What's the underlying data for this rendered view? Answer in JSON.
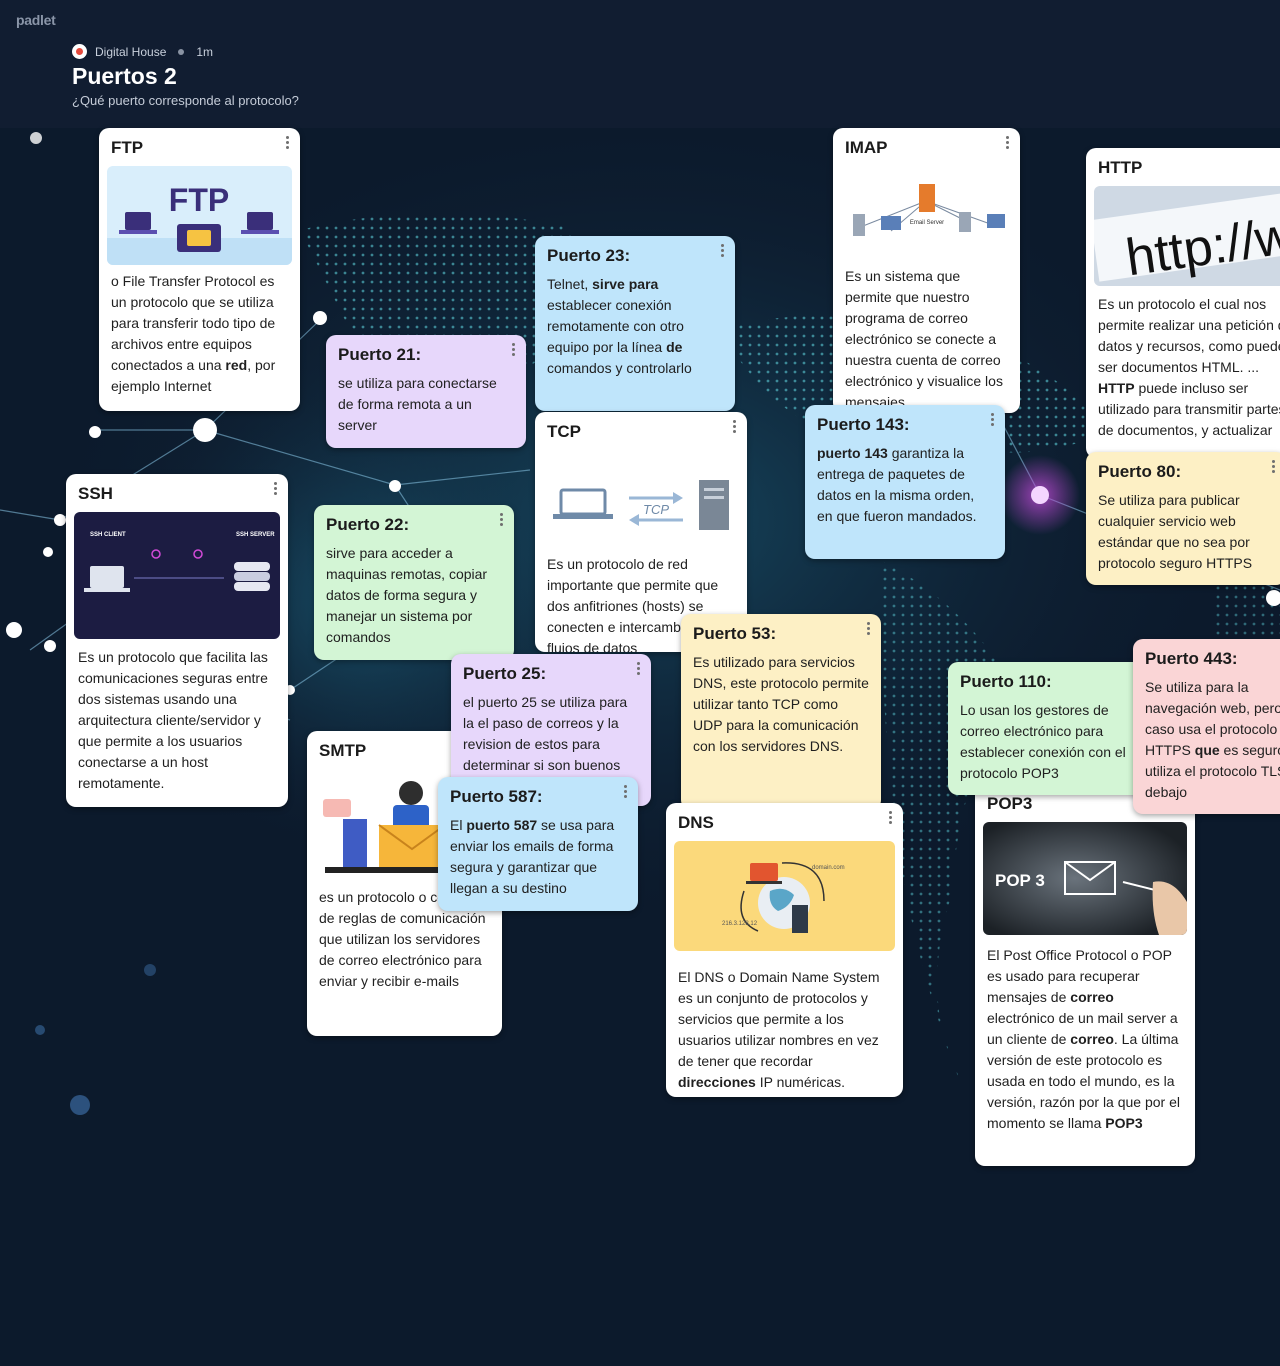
{
  "brand": "padlet",
  "header": {
    "author": "Digital House",
    "time": "1m",
    "title": "Puertos 2",
    "subtitle": "¿Qué puerto corresponde al protocolo?"
  },
  "colors": {
    "background": "#0f1b2e",
    "purple": "#e7d7fb",
    "blue": "#bfe5fb",
    "green": "#d3f5d5",
    "yellow": "#fdf0c5",
    "pink": "#fad5d6"
  },
  "cards": {
    "ftp": {
      "title": "FTP",
      "image_text": "FTP",
      "b1": "o File Transfer Protocol es un protocolo que se utiliza para transferir todo tipo de archivos entre equipos conectados a una ",
      "b2": "red",
      "b3": ", por ejemplo Internet"
    },
    "puerto21": {
      "title": "Puerto 21:",
      "body": "se utiliza para conectarse de forma remota a un server"
    },
    "puerto23": {
      "title": "Puerto 23:",
      "b1": "Telnet, ",
      "b2": "sirve para",
      "b3": " establecer conexión remotamente con otro equipo por la línea ",
      "b4": "de",
      "b5": " comandos y controlarlo"
    },
    "imap": {
      "title": "IMAP",
      "image_text": "Email Server",
      "body": "Es un sistema que permite que nuestro programa de correo electrónico se conecte a nuestra cuenta de correo electrónico y visualice los mensajes"
    },
    "http": {
      "title": "HTTP",
      "image_text": "http://ww",
      "b1": "Es un protocolo el cual nos permite realizar una petición de datos y recursos, como pueden ser documentos HTML. ... ",
      "b2": "HTTP",
      "b3": " puede incluso ser utilizado para transmitir partes de documentos, y actualizar"
    },
    "tcp": {
      "title": "TCP",
      "image_text": "TCP",
      "body": "Es un protocolo de red importante que permite que dos anfitriones (hosts) se conecten e intercambien flujos de datos"
    },
    "puerto143": {
      "title": "Puerto 143:",
      "b1": "puerto 143",
      "b2": " garantiza la entrega de paquetes de datos en la misma orden, en que fueron mandados."
    },
    "puerto80": {
      "title": "Puerto 80:",
      "body": "Se utiliza para publicar cualquier servicio web estándar que no sea por protocolo seguro HTTPS"
    },
    "ssh": {
      "title": "SSH",
      "image_client": "SSH CLIENT",
      "image_server": "SSH SERVER",
      "body": "Es un protocolo que facilita las comunicaciones seguras entre dos sistemas usando una arquitectura cliente/servidor y que permite a los usuarios conectarse a un host remotamente."
    },
    "puerto22": {
      "title": "Puerto 22:",
      "body": "sirve para acceder a maquinas remotas,  copiar datos de forma segura y manejar un sistema por comandos"
    },
    "puerto53": {
      "title": "Puerto 53:",
      "body": "Es utilizado para servicios DNS, este protocolo permite utilizar tanto TCP como UDP para la comunicación con los servidores DNS."
    },
    "puerto25": {
      "title": "Puerto 25:",
      "body": "el puerto 25 se utiliza para la el paso de correos y la revision de estos para determinar si son buenos"
    },
    "smtp": {
      "title": "SMTP",
      "body": "es un protocolo o conjunto de reglas de comunicación que utilizan los servidores de correo electrónico para enviar y recibir e-mails"
    },
    "puerto587": {
      "title": "Puerto 587:",
      "b1": "El ",
      "b2": "puerto 587",
      "b3": " se usa para enviar los emails de forma segura y garantizar que llegan a su destino"
    },
    "dns": {
      "title": "DNS",
      "image_domain": "domain.com",
      "image_ip": "216.3.128.12",
      "b1": "El DNS o Domain Name System es un conjunto de protocolos y servicios que permite a los usuarios utilizar nombres en vez de tener que recordar ",
      "b2": "direcciones",
      "b3": " IP numéricas."
    },
    "puerto110": {
      "title": "Puerto 110:",
      "body": "Lo usan los gestores de correo electrónico para establecer conexión con el protocolo POP3"
    },
    "puerto443": {
      "title": "Puerto 443:",
      "b1": "Se utiliza para la navegación web, pero este caso usa el protocolo HTTPS ",
      "b2": "que",
      "b3": " es seguro y utiliza el protocolo TLS debajo"
    },
    "pop3": {
      "title": "POP3",
      "image_text": "POP 3",
      "b1": "El Post Office Protocol o POP es usado para recuperar mensajes de ",
      "b2": "correo",
      "b3": " electrónico de un mail server a un cliente de ",
      "b4": "correo",
      "b5": ". La última versión de este protocolo es usada en todo el mundo, es la versión, razón por la que por el momento se llama ",
      "b6": "POP3"
    }
  }
}
